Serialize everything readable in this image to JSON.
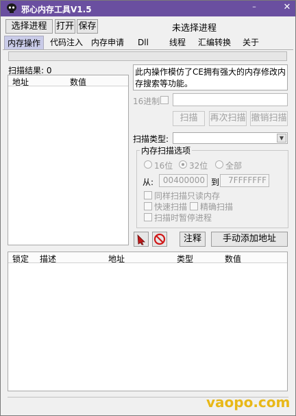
{
  "window": {
    "title": "邪心内存工具V1.5",
    "minimize_glyph": "–",
    "close_glyph": "✕"
  },
  "toolbar": {
    "select_process": "选择进程",
    "open": "打开",
    "save": "保存",
    "status": "未选择进程"
  },
  "tabs": [
    "内存操作",
    "代码注入",
    "内存申请",
    "Dll",
    "线程",
    "汇编转换",
    "关于"
  ],
  "scan": {
    "result_label": "扫描结果: 0",
    "columns": [
      "地址",
      "数值"
    ],
    "description": "此内操作模仿了CE拥有强大的内存修改内存搜索等功能。",
    "hex_label": "16进制",
    "value_input": "",
    "scan_button": "扫描",
    "rescan_button": "再次扫描",
    "cancel_button": "撤销扫描",
    "scan_type_label": "扫描类型:",
    "scan_type_value": ""
  },
  "options": {
    "group_title": "内存扫描选项",
    "radio_16": "16位",
    "radio_32": "32位",
    "radio_all": "全部",
    "from_label": "从:",
    "from_value": "00400000",
    "to_label": "到",
    "to_value": "7FFFFFFF",
    "scan_readonly": "同样扫描只读内存",
    "fast_scan": "快速扫描",
    "precise_scan": "精确扫描",
    "pause_on_scan": "扫描时暂停进程"
  },
  "actions": {
    "comment_button": "注释",
    "add_address_button": "手动添加地址"
  },
  "address_table": {
    "columns": [
      "锁定",
      "描述",
      "地址",
      "类型",
      "数值"
    ]
  },
  "watermark": "vaopo.com",
  "colors": {
    "titlebar": "#6a4fa0",
    "active_tab": "#c9cbe8",
    "watermark": "#e8b818"
  },
  "icons": {
    "app": "skull-icon",
    "pointer": "arrow-pointer-icon",
    "stop": "no-entry-icon"
  }
}
